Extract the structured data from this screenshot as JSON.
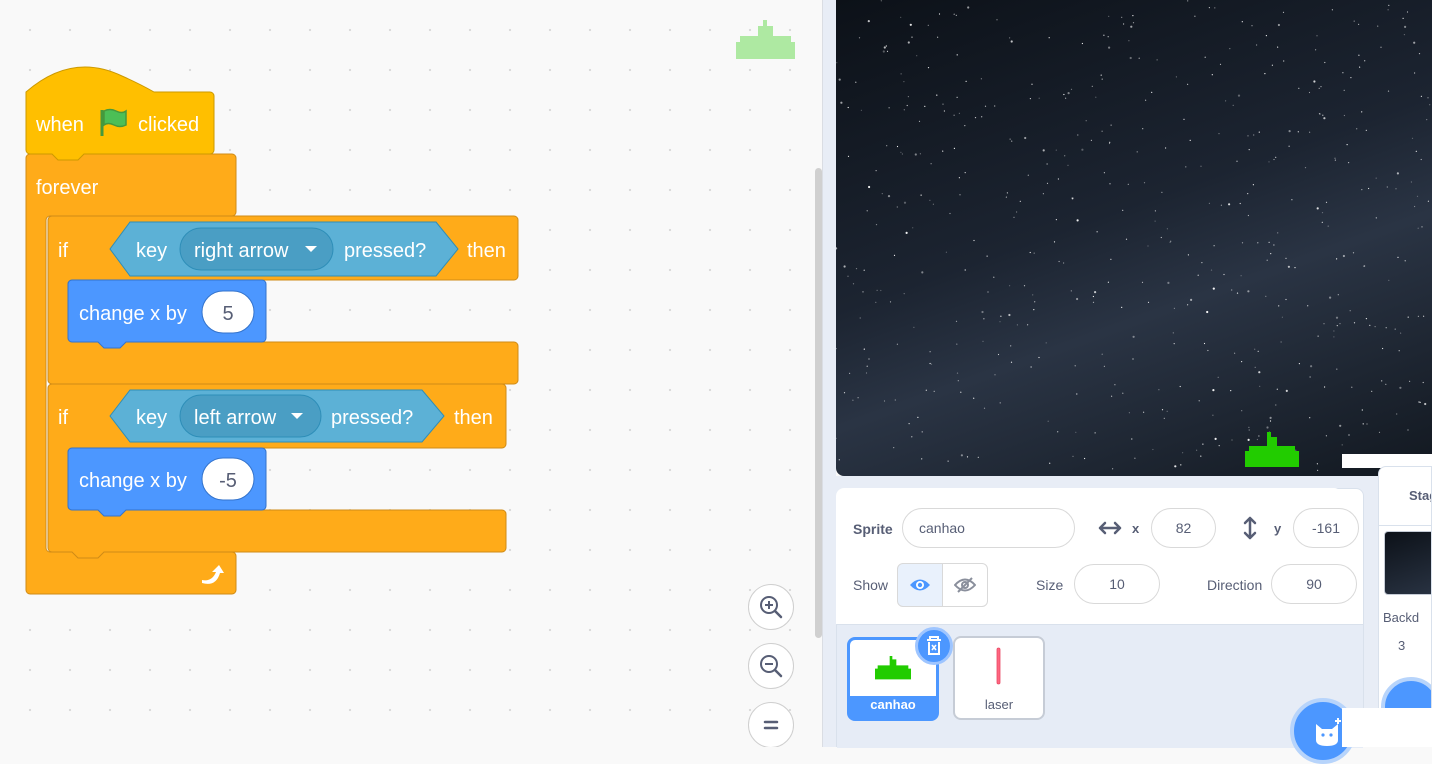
{
  "blocks": {
    "hat": {
      "when": "when",
      "clicked": "clicked"
    },
    "forever": "forever",
    "if1": {
      "if": "if",
      "key": "key",
      "key_value": "right arrow",
      "pressed": "pressed?",
      "then": "then",
      "change_label": "change x by",
      "change_value": "5"
    },
    "if2": {
      "if": "if",
      "key": "key",
      "key_value": "left arrow",
      "pressed": "pressed?",
      "then": "then",
      "change_label": "change x by",
      "change_value": "-5"
    }
  },
  "zoom": {
    "in_icon": "zoom-in-icon",
    "out_icon": "zoom-out-icon",
    "reset_icon": "zoom-reset-icon"
  },
  "sprite_info": {
    "sprite_label": "Sprite",
    "sprite_name": "canhao",
    "x_label": "x",
    "x_value": "82",
    "y_label": "y",
    "y_value": "-161",
    "show_label": "Show",
    "size_label": "Size",
    "size_value": "10",
    "direction_label": "Direction",
    "direction_value": "90"
  },
  "sprites": [
    {
      "name": "canhao",
      "selected": true
    },
    {
      "name": "laser",
      "selected": false
    }
  ],
  "stage_panel": {
    "title": "Stag",
    "backdrops_label": "Backd",
    "backdrops_count": "3"
  },
  "colors": {
    "events": "#ffbf00",
    "control": "#ffab19",
    "sensing": "#5cb1d6",
    "motion": "#4c97ff",
    "accent": "#4c97ff",
    "sprite_green": "#22cc00"
  }
}
